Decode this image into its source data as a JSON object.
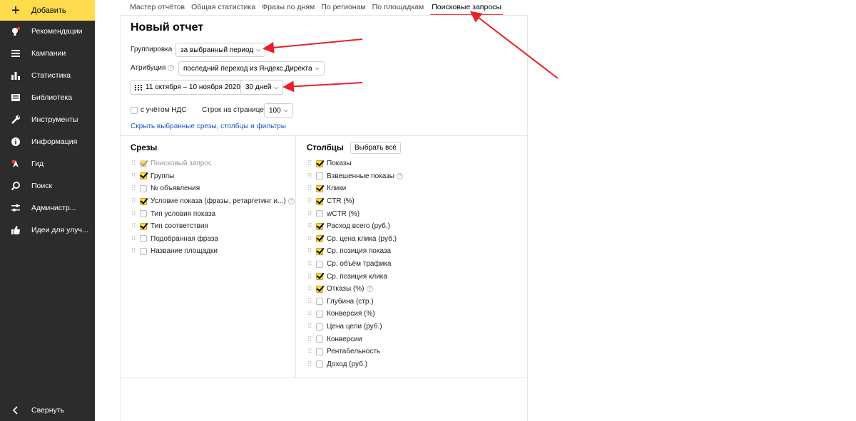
{
  "sidebar": {
    "add_label": "Добавить",
    "items": [
      {
        "label": "Рекомендации",
        "icon": "bulb-icon"
      },
      {
        "label": "Кампании",
        "icon": "menu-icon"
      },
      {
        "label": "Статистика",
        "icon": "stats-icon"
      },
      {
        "label": "Библиотека",
        "icon": "library-icon"
      },
      {
        "label": "Инструменты",
        "icon": "wrench-icon"
      },
      {
        "label": "Информация",
        "icon": "info-icon"
      },
      {
        "label": "Гид",
        "icon": "guide-icon"
      },
      {
        "label": "Поиск",
        "icon": "search-icon"
      },
      {
        "label": "Администр...",
        "icon": "sliders-icon"
      },
      {
        "label": "Идеи для улуч...",
        "icon": "thumb-up-icon"
      }
    ],
    "collapse_label": "Свернуть"
  },
  "tabs": [
    {
      "label": "Мастер отчётов",
      "active": false
    },
    {
      "label": "Общая статистика",
      "active": false
    },
    {
      "label": "Фразы по дням",
      "active": false
    },
    {
      "label": "По регионам",
      "active": false
    },
    {
      "label": "По площадкам",
      "active": false
    },
    {
      "label": "Поисковые запросы",
      "active": true
    }
  ],
  "report": {
    "title": "Новый отчет",
    "grouping_label": "Группировка",
    "grouping_value": "за выбранный период",
    "attribution_label": "Атрибуция",
    "attribution_value": "последний переход из Яндекс.Директа",
    "date_range": "11 октября – 10 ноября 2020",
    "period_value": "30 дней",
    "vat_label": "с учётом НДС",
    "rows_label": "Строк на странице",
    "rows_value": "100",
    "hide_link": "Скрыть выбранные срезы, столбцы и фильтры"
  },
  "slices": {
    "title": "Срезы",
    "items": [
      {
        "label": "Поисковый запрос",
        "checked": true,
        "disabled": true
      },
      {
        "label": "Группы",
        "checked": true
      },
      {
        "label": "№ объявления",
        "checked": false
      },
      {
        "label": "Условие показа (фразы, ретаргетинг и...)",
        "checked": true,
        "help": true
      },
      {
        "label": "Тип условия показа",
        "checked": false
      },
      {
        "label": "Тип соответствия",
        "checked": true
      },
      {
        "label": "Подобранная фраза",
        "checked": false
      },
      {
        "label": "Название площадки",
        "checked": false
      }
    ]
  },
  "columns": {
    "title": "Столбцы",
    "select_all": "Выбрать всё",
    "items": [
      {
        "label": "Показы",
        "checked": true
      },
      {
        "label": "Взвешенные показы",
        "checked": false,
        "help": true
      },
      {
        "label": "Клики",
        "checked": true
      },
      {
        "label": "CTR (%)",
        "checked": true
      },
      {
        "label": "wCTR (%)",
        "checked": false
      },
      {
        "label": "Расход всего (руб.)",
        "checked": true
      },
      {
        "label": "Ср. цена клика (руб.)",
        "checked": true
      },
      {
        "label": "Ср. позиция показа",
        "checked": true
      },
      {
        "label": "Ср. объём трафика",
        "checked": false
      },
      {
        "label": "Ср. позиция клика",
        "checked": true
      },
      {
        "label": "Отказы (%)",
        "checked": true,
        "help": true
      },
      {
        "label": "Глубина (стр.)",
        "checked": false
      },
      {
        "label": "Конверсия (%)",
        "checked": false
      },
      {
        "label": "Цена цели (руб.)",
        "checked": false
      },
      {
        "label": "Конверсии",
        "checked": false
      },
      {
        "label": "Рентабельность",
        "checked": false
      },
      {
        "label": "Доход (руб.)",
        "checked": false
      }
    ]
  },
  "colors": {
    "sidebar_bg": "#2c2c2c",
    "accent_yellow": "#ffdb4d",
    "arrow_red": "#e8202a",
    "link_blue": "#1a55c8"
  }
}
